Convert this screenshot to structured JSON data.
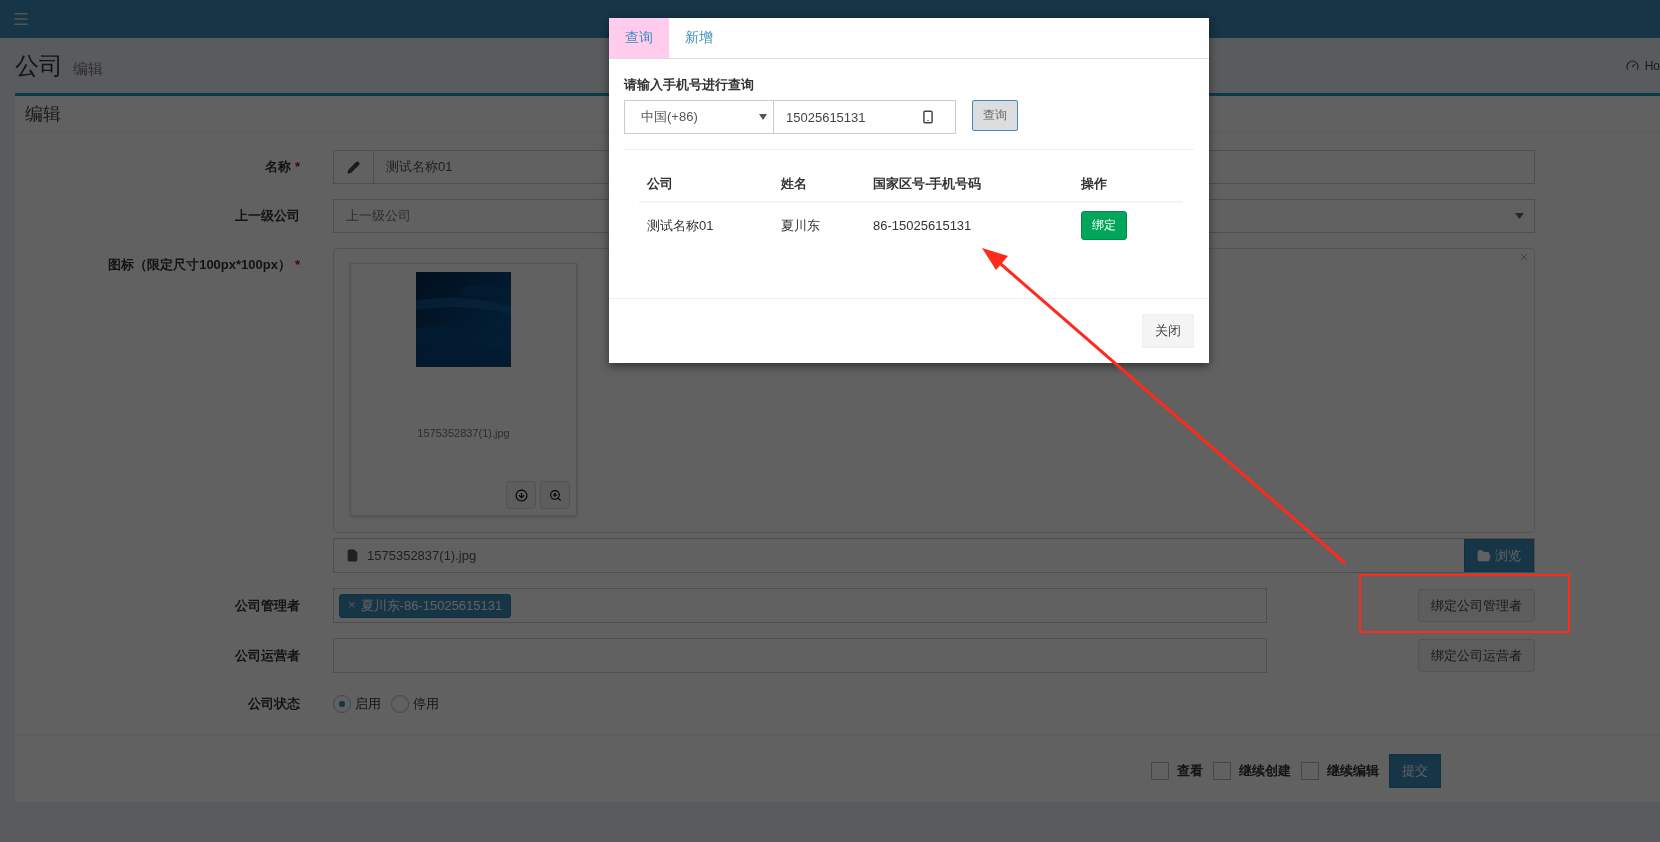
{
  "header": {
    "title": "公司",
    "subtitle": "编辑",
    "breadcrumb": "Ho"
  },
  "box": {
    "title": "编辑"
  },
  "form": {
    "name": {
      "label": "名称",
      "required_mark": "*",
      "value": "测试名称01"
    },
    "parent": {
      "label": "上一级公司",
      "placeholder": "上一级公司"
    },
    "icon": {
      "label": "图标（限定尺寸100px*100px）",
      "required_mark": "*",
      "preview": {
        "kind": "picture",
        "filename": "1575352837(1).jpg"
      },
      "file_caption": "1575352837(1).jpg",
      "browse_button": "浏览"
    },
    "managers": {
      "label": "公司管理者",
      "tags": [
        {
          "remove": "×",
          "text": "夏川东-86-15025615131"
        }
      ],
      "button": "绑定公司管理者"
    },
    "operators": {
      "label": "公司运营者",
      "button": "绑定公司运营者"
    },
    "status": {
      "label": "公司状态",
      "options": [
        {
          "label": "启用",
          "selected": true
        },
        {
          "label": "停用",
          "selected": false
        }
      ]
    }
  },
  "footer": {
    "checks": [
      {
        "label": "查看",
        "checked": false
      },
      {
        "label": "继续创建",
        "checked": false
      },
      {
        "label": "继续编辑",
        "checked": false
      }
    ],
    "submit": "提交"
  },
  "modal": {
    "tabs": [
      {
        "label": "查询",
        "selected": true
      },
      {
        "label": "新增",
        "selected": false
      }
    ],
    "prompt": "请输入手机号进行查询",
    "country": "中国(+86)",
    "phone": "15025615131",
    "query_button": "查询",
    "table": {
      "columns": [
        "公司",
        "姓名",
        "国家区号-手机号码",
        "操作"
      ],
      "rows": [
        {
          "company": "测试名称01",
          "name": "夏川东",
          "phone": "86-15025615131",
          "action": "绑定"
        }
      ]
    },
    "close_button": "关闭"
  }
}
